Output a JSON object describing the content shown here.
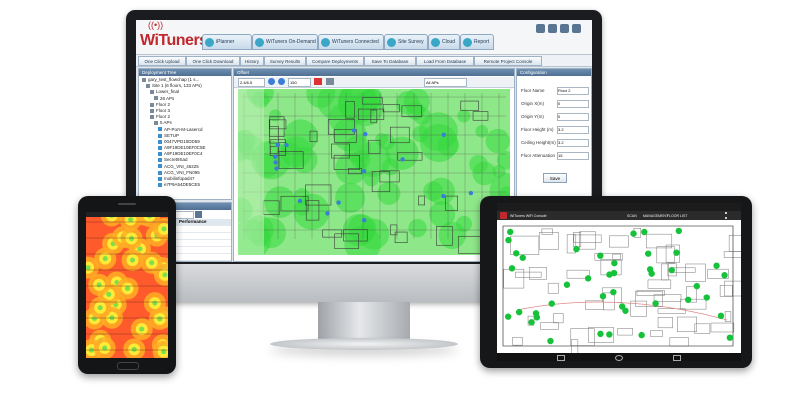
{
  "brand": {
    "name": "WiTuners",
    "accent": "#c0282d",
    "heat_green": "#2fdc3a",
    "ap_green": "#16c23a"
  },
  "desktop": {
    "main_tabs": [
      "iPlanner",
      "WiTuners On-Demand",
      "WiTuners Connected",
      "Site Survey",
      "Cloud",
      "Report"
    ],
    "toolbar": [
      "One Click Upload",
      "One Click Download",
      "History",
      "Survey Results",
      "Compare Deployments",
      "Save To Database",
      "Load From Database",
      "Remote Project Console"
    ],
    "deployment_tree": {
      "title": "Deployment Tree",
      "rows": [
        "gary_test_flowchap (1 s...",
        "Site 1 (6 floors, 133 APs)",
        "Lower_final",
        "26 APs",
        "Floor 2",
        "Floor 3",
        "Floor 2",
        "5 APs",
        "AP-Port-M-Lasercd",
        "SETUP",
        "0047VPD10DD59",
        "A9F19DE10EF0C5E",
        "A9F19DE10EF0C4",
        "Secret9Sad",
        "ACG_VNI_46225",
        "ACG_VNI_FN095",
        "mobilinfopad47",
        "e7P9A54DE5CE5"
      ],
      "icons": [
        "minus-icon",
        "minus-icon",
        "minus-icon",
        "wifi-icon",
        "plus-icon",
        "plus-icon",
        "minus-icon",
        "minus-icon",
        "ap-icon",
        "ap-icon",
        "ap-icon",
        "ap-icon",
        "ap-icon",
        "ap-icon",
        "ap-icon",
        "ap-icon",
        "ap-icon",
        "ap-icon"
      ]
    },
    "search": {
      "title": "Search for APs",
      "dropdown": "Coordinates",
      "column": "Performance",
      "rows": [
        "Good",
        "Good",
        "Good",
        "Good",
        "Good"
      ]
    },
    "map": {
      "title": "Offset",
      "zoom": "150",
      "layer": "2.4/6.5",
      "filter": "All APs"
    },
    "configuration": {
      "title": "Configuration",
      "fields": [
        {
          "label": "Floor Name",
          "value": "Floor 2"
        },
        {
          "label": "Origin X(m)",
          "value": "0"
        },
        {
          "label": "Origin Y(m)",
          "value": "0"
        },
        {
          "label": "Floor Height (m)",
          "value": "3.2"
        },
        {
          "label": "Ceiling Height(m)",
          "value": "3.2"
        },
        {
          "label": "Floor Attenuation",
          "value": "15"
        }
      ],
      "save_label": "Save"
    },
    "stats": {
      "title": "Stats"
    }
  },
  "tablet": {
    "app_title": "WiTuners WiFi Console",
    "tabs": [
      "SCAN",
      "MANAGEMENT",
      "FLOOR LIST"
    ],
    "floor_label": "LOWER LEVEL"
  }
}
